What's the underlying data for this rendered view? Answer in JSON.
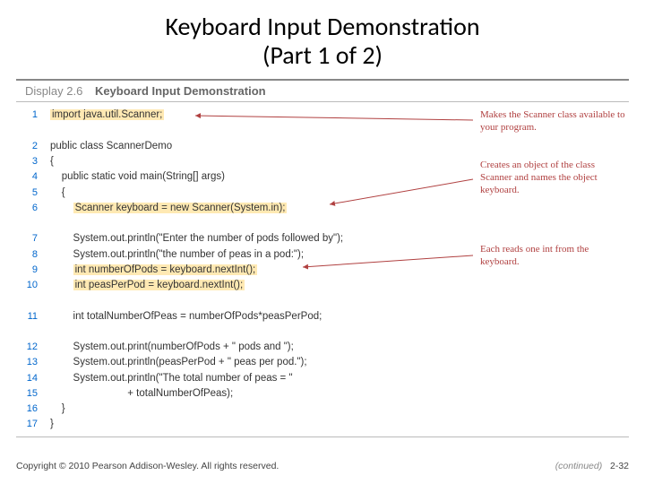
{
  "title_line1": "Keyboard Input Demonstration",
  "title_line2": "(Part 1 of 2)",
  "display": {
    "label": "Display 2.6",
    "caption": "Keyboard Input Demonstration"
  },
  "code": [
    {
      "n": "1",
      "pre": "",
      "hl": "import java.util.Scanner;",
      "post": ""
    },
    {
      "n": "",
      "pre": " ",
      "hl": "",
      "post": ""
    },
    {
      "n": "2",
      "pre": "public class ScannerDemo",
      "hl": "",
      "post": ""
    },
    {
      "n": "3",
      "pre": "{",
      "hl": "",
      "post": ""
    },
    {
      "n": "4",
      "pre": "    public static void main(String[] args)",
      "hl": "",
      "post": ""
    },
    {
      "n": "5",
      "pre": "    {",
      "hl": "",
      "post": ""
    },
    {
      "n": "6",
      "pre": "        ",
      "hl": "Scanner keyboard = new Scanner(System.in);",
      "post": ""
    },
    {
      "n": "",
      "pre": " ",
      "hl": "",
      "post": ""
    },
    {
      "n": "7",
      "pre": "        System.out.println(\"Enter the number of pods followed by\");",
      "hl": "",
      "post": ""
    },
    {
      "n": "8",
      "pre": "        System.out.println(\"the number of peas in a pod:\");",
      "hl": "",
      "post": ""
    },
    {
      "n": "9",
      "pre": "        ",
      "hl": "int numberOfPods = keyboard.nextInt();",
      "post": ""
    },
    {
      "n": "10",
      "pre": "        ",
      "hl": "int peasPerPod = keyboard.nextInt();",
      "post": ""
    },
    {
      "n": "",
      "pre": " ",
      "hl": "",
      "post": ""
    },
    {
      "n": "11",
      "pre": "        int totalNumberOfPeas = numberOfPods*peasPerPod;",
      "hl": "",
      "post": ""
    },
    {
      "n": "",
      "pre": " ",
      "hl": "",
      "post": ""
    },
    {
      "n": "12",
      "pre": "        System.out.print(numberOfPods + \" pods and \");",
      "hl": "",
      "post": ""
    },
    {
      "n": "13",
      "pre": "        System.out.println(peasPerPod + \" peas per pod.\");",
      "hl": "",
      "post": ""
    },
    {
      "n": "14",
      "pre": "        System.out.println(\"The total number of peas = \"",
      "hl": "",
      "post": ""
    },
    {
      "n": "15",
      "pre": "                           + totalNumberOfPeas);",
      "hl": "",
      "post": ""
    },
    {
      "n": "16",
      "pre": "    }",
      "hl": "",
      "post": ""
    },
    {
      "n": "17",
      "pre": "}",
      "hl": "",
      "post": ""
    }
  ],
  "annotations": {
    "a1": "Makes the Scanner class available to your program.",
    "a2": "Creates an object of the class Scanner and names the object keyboard.",
    "a3": "Each reads one int from the keyboard."
  },
  "footer": {
    "copyright": "Copyright © 2010 Pearson Addison-Wesley. All rights reserved.",
    "continued": "(continued)",
    "page": "2-32"
  }
}
